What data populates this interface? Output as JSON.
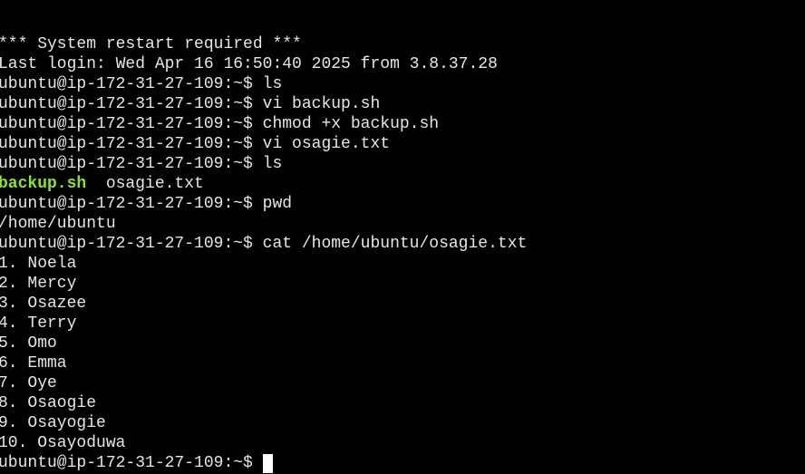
{
  "terminal": {
    "colors": {
      "background": "#000000",
      "foreground": "#e6e6e6",
      "executable": "#8ae234",
      "cursor": "#ffffff"
    },
    "lines": [
      "*** System restart required ***",
      "Last login: Wed Apr 16 16:50:40 2025 from 3.8.37.28",
      "ubuntu@ip-172-31-27-109:~$ ls",
      "ubuntu@ip-172-31-27-109:~$ vi backup.sh",
      "ubuntu@ip-172-31-27-109:~$ chmod +x backup.sh",
      "ubuntu@ip-172-31-27-109:~$ vi osagie.txt",
      "ubuntu@ip-172-31-27-109:~$ ls"
    ],
    "ls_output": {
      "executable": "backup.sh",
      "separator": "  ",
      "file": "osagie.txt"
    },
    "lines_after_ls": [
      "ubuntu@ip-172-31-27-109:~$ pwd",
      "/home/ubuntu",
      "ubuntu@ip-172-31-27-109:~$ cat /home/ubuntu/osagie.txt",
      "1. Noela",
      "2. Mercy",
      "3. Osazee",
      "4. Terry",
      "5. Omo",
      "6. Emma",
      "7. Oye",
      "8. Osaogie",
      "9. Osayogie",
      "10. Osayoduwa"
    ],
    "prompt": "ubuntu@ip-172-31-27-109:~$ "
  }
}
